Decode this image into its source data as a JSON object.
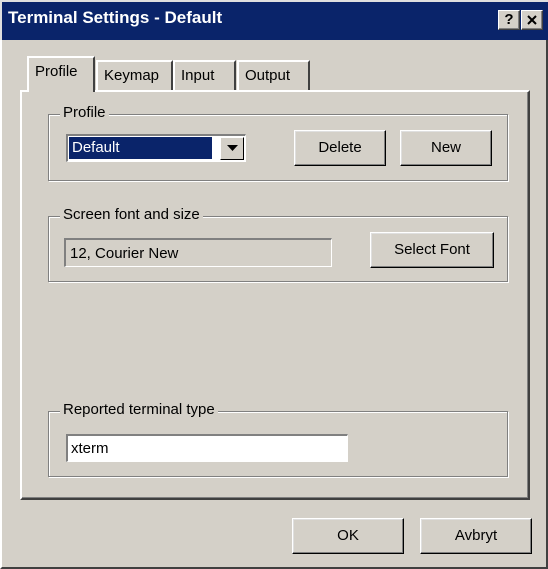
{
  "window": {
    "title": "Terminal Settings - Default",
    "help_label": "?",
    "close_label": "✕"
  },
  "tabs": [
    {
      "label": "Profile",
      "selected": true
    },
    {
      "label": "Keymap",
      "selected": false
    },
    {
      "label": "Input",
      "selected": false
    },
    {
      "label": "Output",
      "selected": false
    }
  ],
  "profile_group": {
    "title": "Profile",
    "selected_value": "Default",
    "delete_label": "Delete",
    "new_label": "New"
  },
  "font_group": {
    "title": "Screen font and size",
    "value": "12, Courier New",
    "select_font_label": "Select Font"
  },
  "terminal_group": {
    "title": "Reported terminal type",
    "value": "xterm"
  },
  "footer": {
    "ok_label": "OK",
    "cancel_label": "Avbryt"
  },
  "colors": {
    "face": "#d4d0c8",
    "title_bar": "#0a246a",
    "selection": "#0a246a"
  }
}
